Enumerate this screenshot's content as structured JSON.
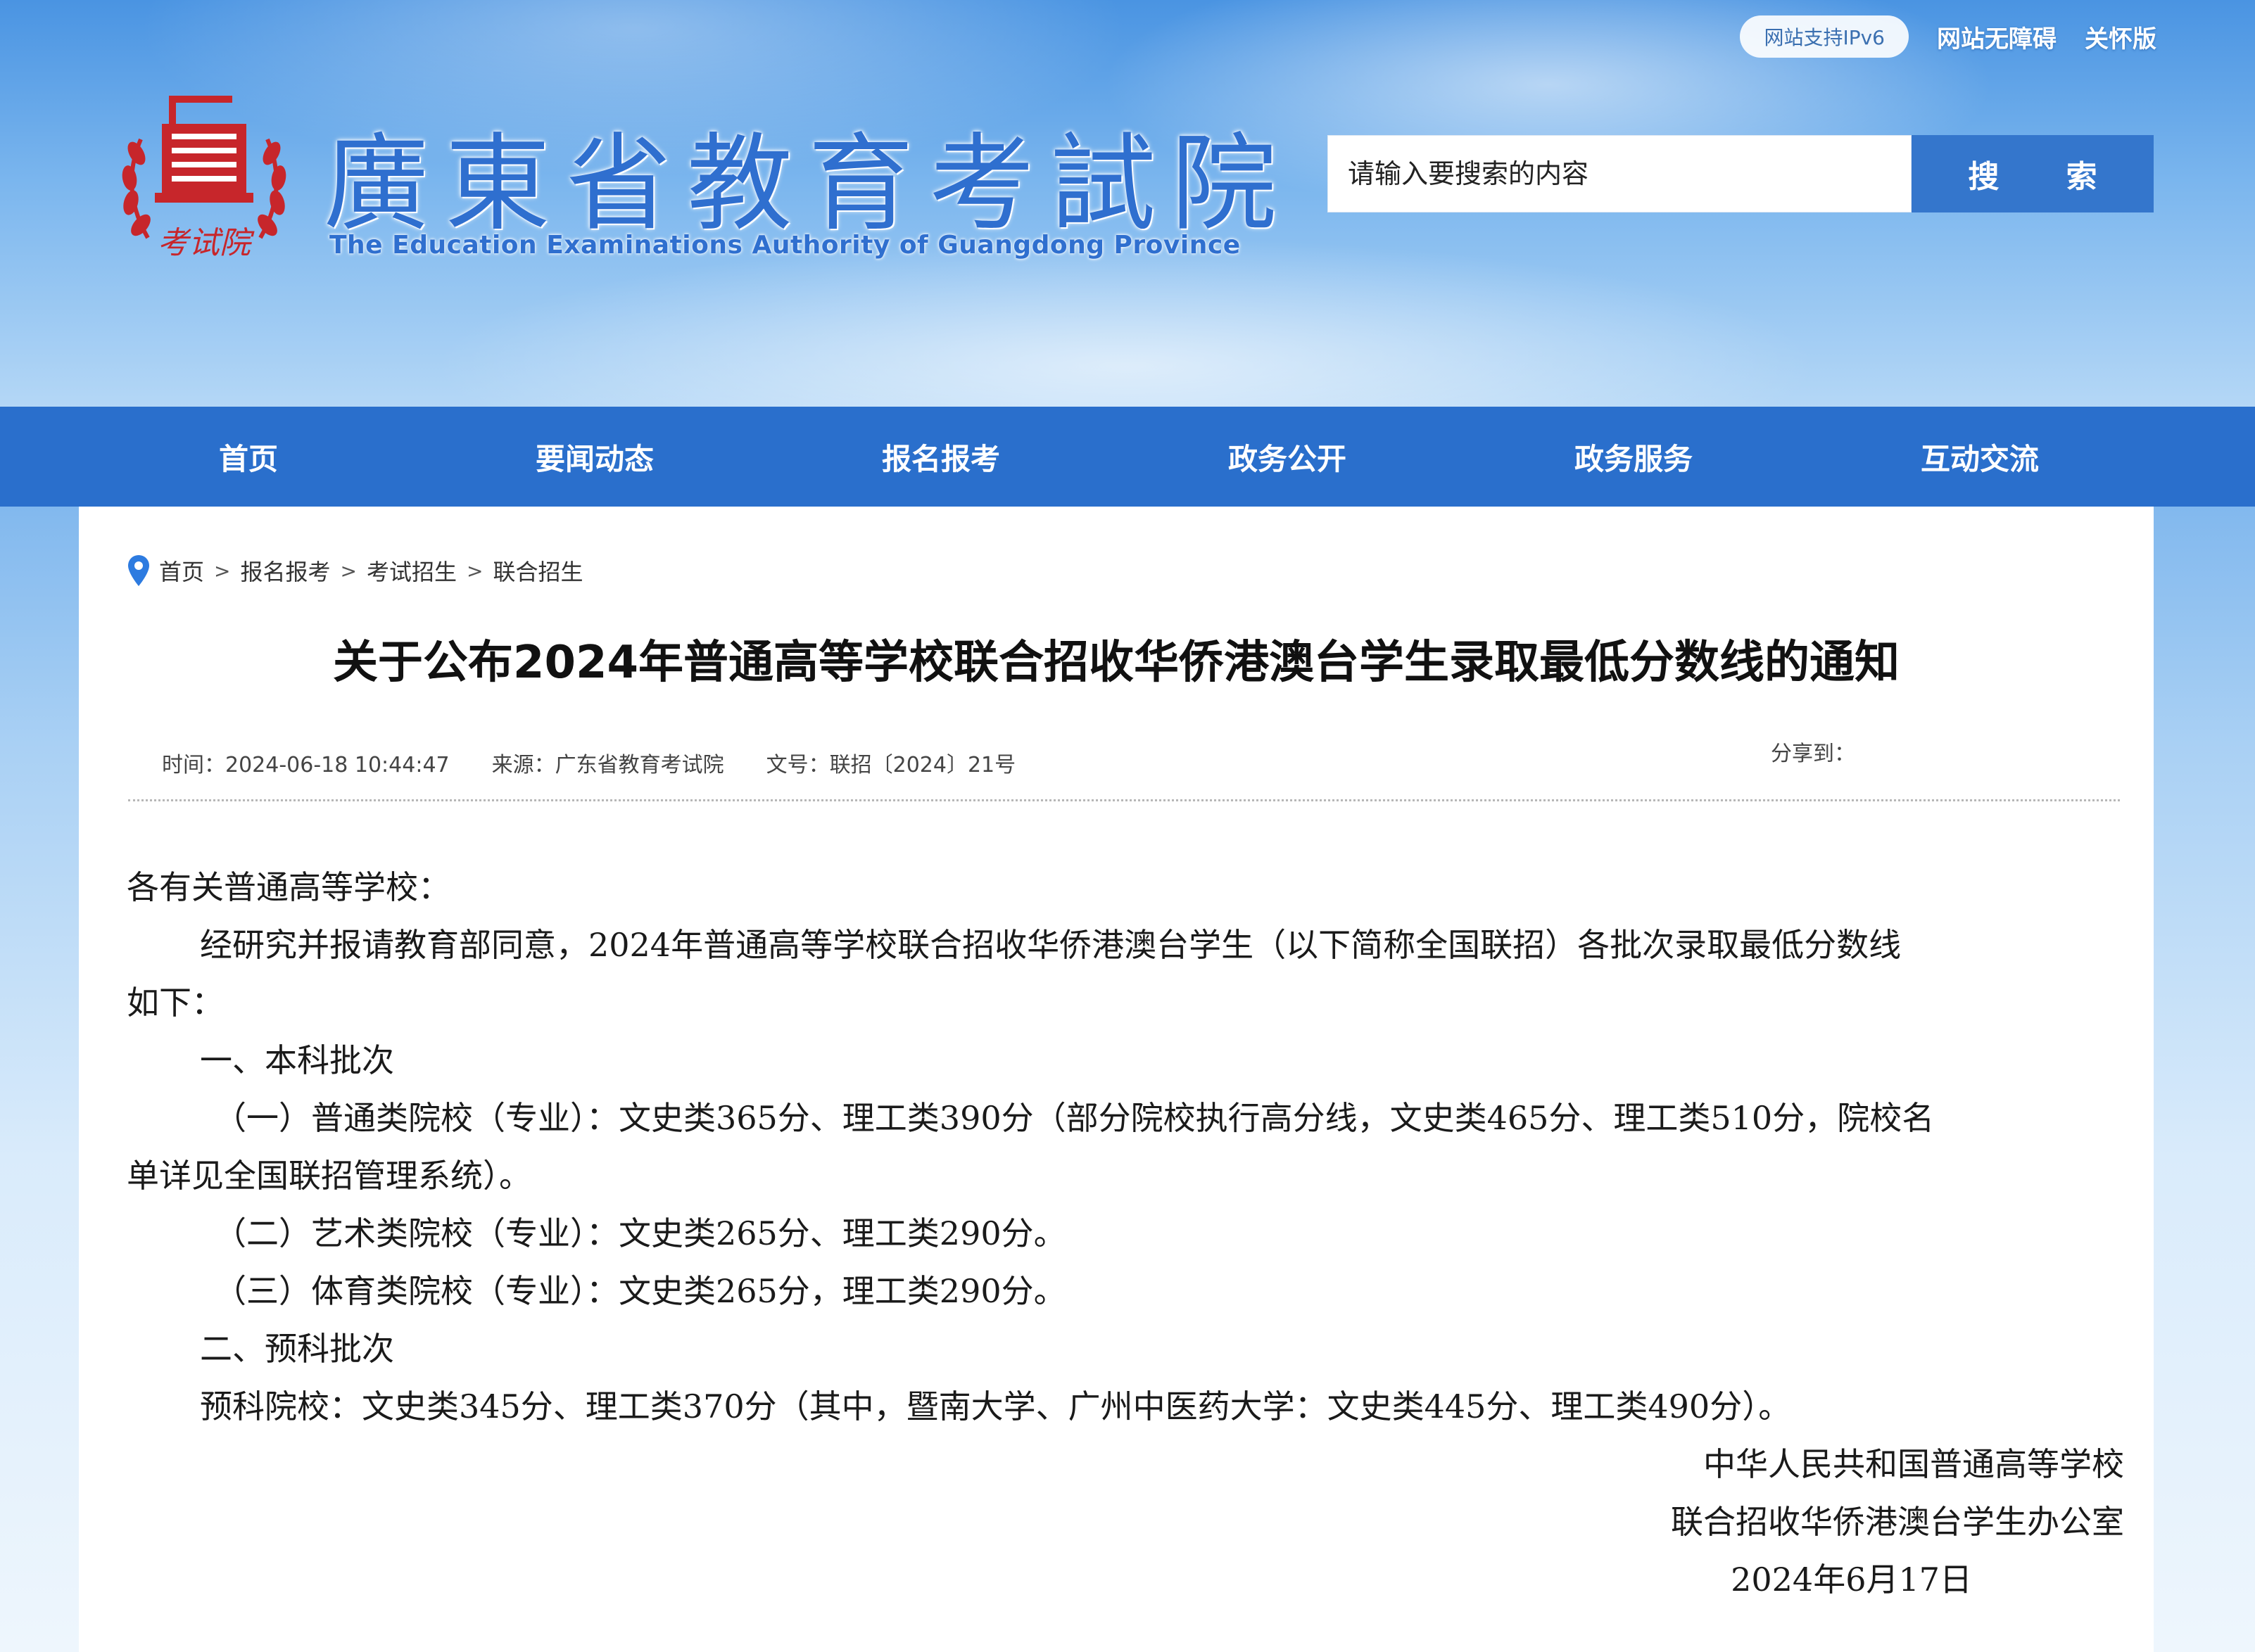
{
  "header": {
    "top_links": [
      "网站支持IPv6",
      "网站无障碍",
      "关怀版"
    ],
    "logo_seal_text": "考试院",
    "site_title": "廣東省教育考試院",
    "site_subtitle": "The Education Examinations Authority of Guangdong Province",
    "search": {
      "placeholder": "请输入要搜索的内容",
      "button_label": "搜 索"
    }
  },
  "nav": {
    "items": [
      "首页",
      "要闻动态",
      "报名报考",
      "政务公开",
      "政务服务",
      "互动交流"
    ]
  },
  "breadcrumb": {
    "items": [
      "首页",
      "报名报考",
      "考试招生",
      "联合招生"
    ],
    "separator": ">"
  },
  "article": {
    "title": "关于公布2024年普通高等学校联合招收华侨港澳台学生录取最低分数线的通知",
    "meta": {
      "time": "时间：2024-06-18 10:44:47",
      "source": "来源：广东省教育考试院",
      "doc_no": "文号：联招〔2024〕21号"
    },
    "share_label": "分享到：",
    "salutation": "各有关普通高等学校：",
    "intro": "经研究并报请教育部同意，2024年普通高等学校联合招收华侨港澳台学生（以下简称全国联招）各批次录取最低分数线",
    "intro_cont": "如下：",
    "sec1_title": "一、本科批次",
    "sec1_item1": "（一）普通类院校（专业）：文史类365分、理工类390分（部分院校执行高分线，文史类465分、理工类510分，院校名",
    "sec1_item1_cont": "单详见全国联招管理系统）。",
    "sec1_item2": "（二）艺术类院校（专业）：文史类265分、理工类290分。",
    "sec1_item3": "（三）体育类院校（专业）：文史类265分，理工类290分。",
    "sec2_title": "二、预科批次",
    "sec2_body": "预科院校：文史类345分、理工类370分（其中，暨南大学、广州中医药大学：文史类445分、理工类490分）。",
    "sign_org1": "中华人民共和国普通高等学校",
    "sign_org2": "联合招收华侨港澳台学生办公室",
    "sign_date": "2024年6月17日"
  },
  "colors": {
    "nav_bg": "#2a6fcc",
    "title_blue": "#2f6fcf",
    "seal_red": "#c7262b",
    "pin_blue": "#2d7be0"
  }
}
